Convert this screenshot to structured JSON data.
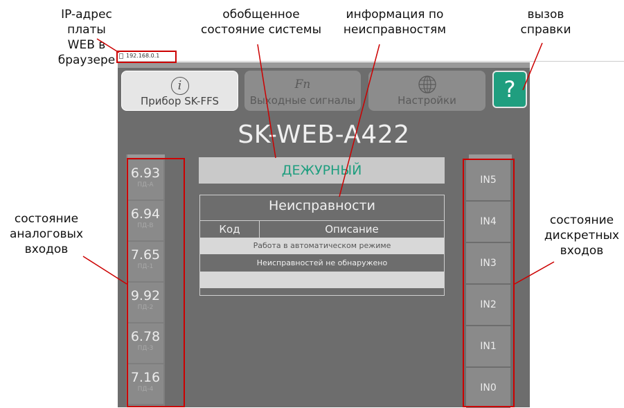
{
  "annotations": {
    "ip": [
      "IP-адрес платы",
      "WEB в браузере"
    ],
    "status": [
      "обобщенное",
      "состояние системы"
    ],
    "faults": [
      "информация по",
      "неисправностям"
    ],
    "help": [
      "вызов",
      "справки"
    ],
    "analog": [
      "состояние",
      "аналоговых",
      "входов"
    ],
    "digital": [
      "состояние",
      "дискретных",
      "входов"
    ]
  },
  "browser": {
    "address": "192.168.0.1"
  },
  "nav": {
    "device_label": "Прибор SK-FFS",
    "outputs_label": "Выходные сигналы",
    "outputs_symbol": "Fn",
    "settings_label": "Настройки",
    "help_label": "?"
  },
  "device_title": "SK-WEB-A422",
  "status": "ДЕЖУРНЫЙ",
  "faults": {
    "title": "Неисправности",
    "col_code": "Код",
    "col_desc": "Описание",
    "rows": [
      "Работа в автоматическом режиме",
      "Неисправностей не обнаружено"
    ]
  },
  "analog_inputs": [
    {
      "value": "6.93",
      "label": "ПД-А"
    },
    {
      "value": "6.94",
      "label": "ПД-В"
    },
    {
      "value": "7.65",
      "label": "ПД-1"
    },
    {
      "value": "9.92",
      "label": "ПД-2"
    },
    {
      "value": "6.78",
      "label": "ПД-3"
    },
    {
      "value": "7.16",
      "label": "ПД-4"
    }
  ],
  "digital_inputs": [
    "IN5",
    "IN4",
    "IN3",
    "IN2",
    "IN1",
    "IN0"
  ],
  "colors": {
    "accent": "#1f9e7f",
    "annotation": "#cc0000",
    "panel": "#6d6d6d"
  }
}
